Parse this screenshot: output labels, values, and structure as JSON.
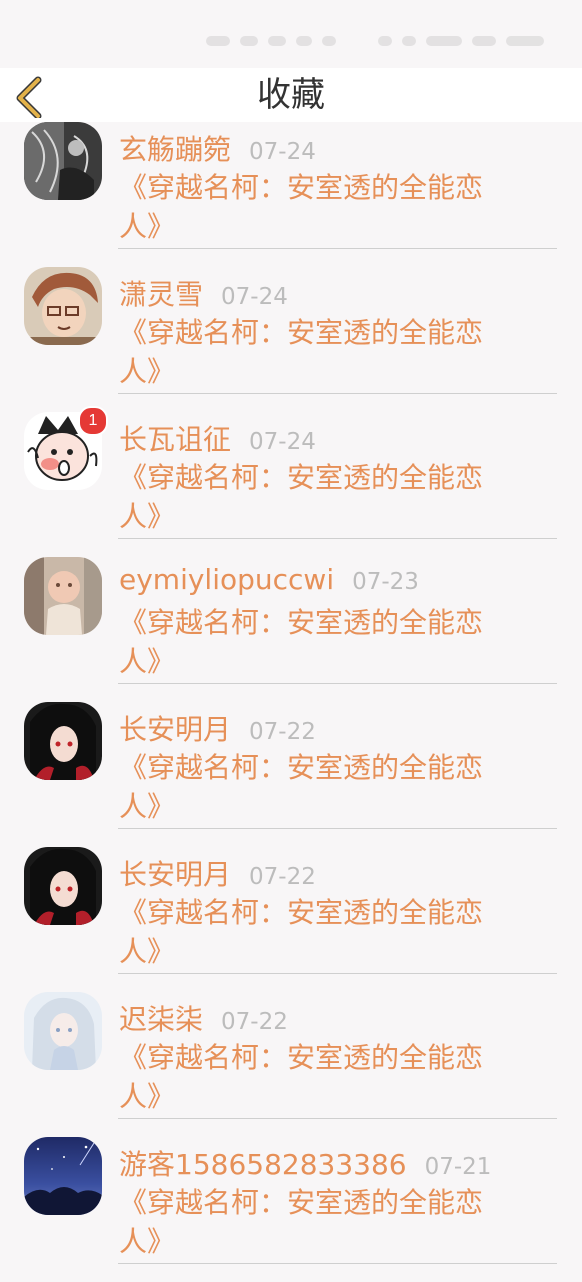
{
  "header": {
    "title": "收藏",
    "back_icon": "chevron-left-icon"
  },
  "colors": {
    "accent": "#e69058",
    "date": "#bcbcbc",
    "back_icon": "#e3b24a",
    "background": "#f8f6f7"
  },
  "items": [
    {
      "name": "玄觞蹦箢",
      "date": "07-24",
      "book": "《穿越名柯：安室透的全能恋人》",
      "avatar": "grayscale-sketch-avatar"
    },
    {
      "name": "潇灵雪",
      "date": "07-24",
      "book": "《穿越名柯：安室透的全能恋人》",
      "avatar": "anime-boy-glasses-avatar"
    },
    {
      "name": "长瓦诅征",
      "date": "07-24",
      "book": "《穿越名柯：安室透的全能恋人》",
      "avatar": "cartoon-kid-avatar",
      "badge": "1"
    },
    {
      "name": "eymiyliopuccwi",
      "date": "07-23",
      "book": "《穿越名柯：安室透的全能恋人》",
      "avatar": "baby-photo-avatar"
    },
    {
      "name": "长安明月",
      "date": "07-22",
      "book": "《穿越名柯：安室透的全能恋人》",
      "avatar": "anime-girl-black-hair-avatar"
    },
    {
      "name": "长安明月",
      "date": "07-22",
      "book": "《穿越名柯：安室透的全能恋人》",
      "avatar": "anime-girl-black-hair-avatar"
    },
    {
      "name": "迟柒柒",
      "date": "07-22",
      "book": "《穿越名柯：安室透的全能恋人》",
      "avatar": "anime-girl-white-hair-avatar"
    },
    {
      "name": "游客1586582833386",
      "date": "07-21",
      "book": "《穿越名柯：安室透的全能恋人》",
      "avatar": "night-sky-avatar"
    }
  ]
}
